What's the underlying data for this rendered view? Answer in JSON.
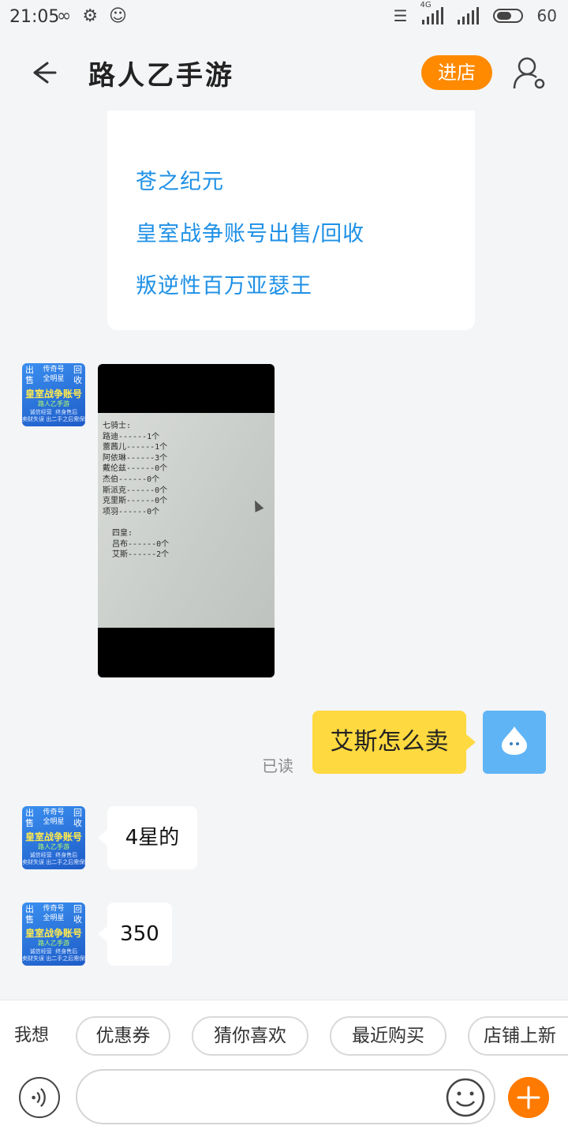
{
  "status_bar": {
    "time": "21:05",
    "left_icons": [
      "infinity-icon",
      "app-icon",
      "gallery-icon"
    ],
    "network": "4G",
    "battery": "60"
  },
  "header": {
    "title": "路人乙手游",
    "enter_store_label": "进店",
    "back_icon": "back-arrow-icon",
    "profile_icon": "profile-settings-icon"
  },
  "card": {
    "lines": [
      "苍之纪元",
      "皇室战争账号出售/回收",
      "叛逆性百万亚瑟王"
    ]
  },
  "avatar": {
    "top_left": "出\n售",
    "top_mid": "传奇号\n全明星",
    "top_right": "回\n收",
    "main": "皇室战争账号",
    "sub": "路人乙手游",
    "bottom": "诚信经营  终身售后\n卖财失误 出二手之后需保障"
  },
  "photo": {
    "lines": [
      "七骑士:",
      "路迪------1个",
      "蕾茜儿------1个",
      "阿依琳------3个",
      "戴伦兹------0个",
      "杰伯------0个",
      "斯派克------0个",
      "克里斯------0个",
      "项羽------0个",
      "",
      "  四皇:",
      "  吕布------0个",
      "  艾斯------2个"
    ]
  },
  "messages": {
    "outgoing_text": "艾斯怎么卖",
    "read_status": "已读",
    "reply1": "4星的",
    "reply2": "350"
  },
  "quick_bar": {
    "label": "我想",
    "chips": [
      "优惠券",
      "猜你喜欢",
      "最近购买",
      "店铺上新"
    ]
  },
  "input_bar": {
    "placeholder": "",
    "accent": "#ff7a00"
  },
  "colors": {
    "accent_orange": "#ff8a00",
    "link_blue": "#1e90e6",
    "bubble_yellow": "#ffd940"
  }
}
